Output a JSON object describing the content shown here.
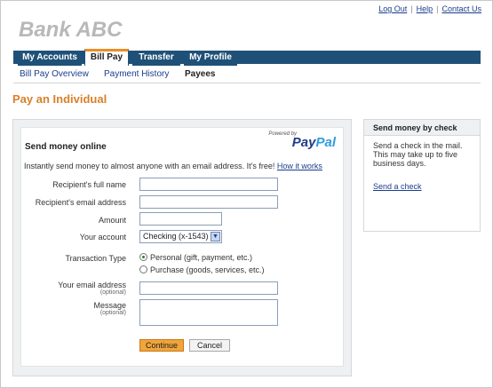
{
  "brand": {
    "logo_text": "Bank ABC"
  },
  "top_links": {
    "logout": "Log Out",
    "help": "Help",
    "contact": "Contact Us",
    "separator": "|"
  },
  "tabs": [
    {
      "label": "My Accounts",
      "active": false
    },
    {
      "label": "Bill Pay",
      "active": true
    },
    {
      "label": "Transfer",
      "active": false
    },
    {
      "label": "My Profile",
      "active": false
    }
  ],
  "subnav": [
    {
      "label": "Bill Pay Overview",
      "current": false
    },
    {
      "label": "Payment History",
      "current": false
    },
    {
      "label": "Payees",
      "current": true
    }
  ],
  "page": {
    "title": "Pay an Individual"
  },
  "paypal": {
    "powered_by": "Powered by",
    "logo_part1": "Pay",
    "logo_part2": "Pal"
  },
  "form": {
    "section_title": "Send money online",
    "intro_text": "Instantly send money to almost anyone with an email address. It's free!",
    "intro_link": "How it works",
    "recipient_name_label": "Recipient's full name",
    "recipient_name_value": "",
    "recipient_email_label": "Recipient's email address",
    "recipient_email_value": "",
    "amount_label": "Amount",
    "amount_value": "",
    "account_label": "Your account",
    "account_selected": "Checking (x-1543)",
    "transaction_type_label": "Transaction Type",
    "transaction_options": [
      {
        "label": "Personal (gift, payment, etc.)",
        "checked": true
      },
      {
        "label": "Purchase (goods, services, etc.)",
        "checked": false
      }
    ],
    "your_email_label": "Your email address",
    "your_email_optional": "(optional)",
    "your_email_value": "",
    "message_label": "Message",
    "message_optional": "(optional)",
    "message_value": "",
    "continue_label": "Continue",
    "cancel_label": "Cancel"
  },
  "side": {
    "title": "Send money by check",
    "body": "Send a check in the mail. This may take up to five business days.",
    "link": "Send a check"
  },
  "colors": {
    "nav": "#1f5178",
    "accent": "#e98f25",
    "title": "#d8802a",
    "link": "#1a3d8c"
  }
}
